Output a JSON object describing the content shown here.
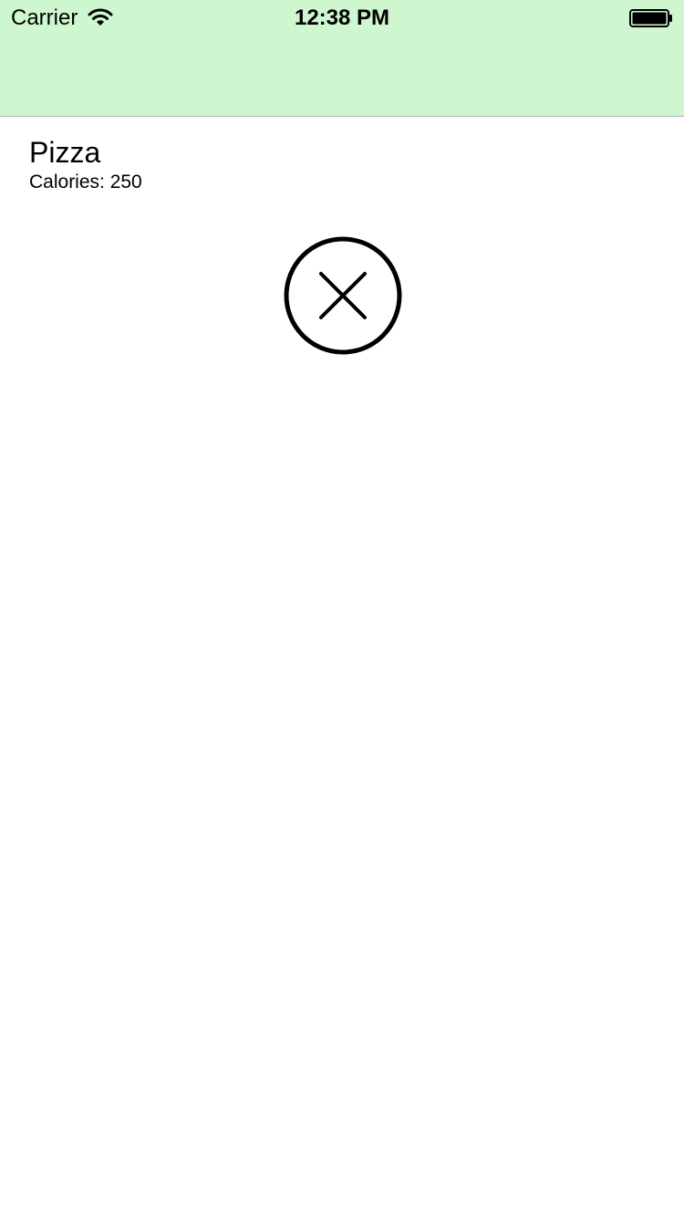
{
  "colors": {
    "nav_background": "#cff7cf",
    "text": "#000000"
  },
  "status_bar": {
    "carrier": "Carrier",
    "time": "12:38 PM",
    "wifi_icon": "wifi-icon",
    "battery_icon": "battery-icon"
  },
  "item": {
    "name": "Pizza",
    "calories_text": "Calories: 250"
  },
  "actions": {
    "delete_icon": "close-circle-icon"
  }
}
